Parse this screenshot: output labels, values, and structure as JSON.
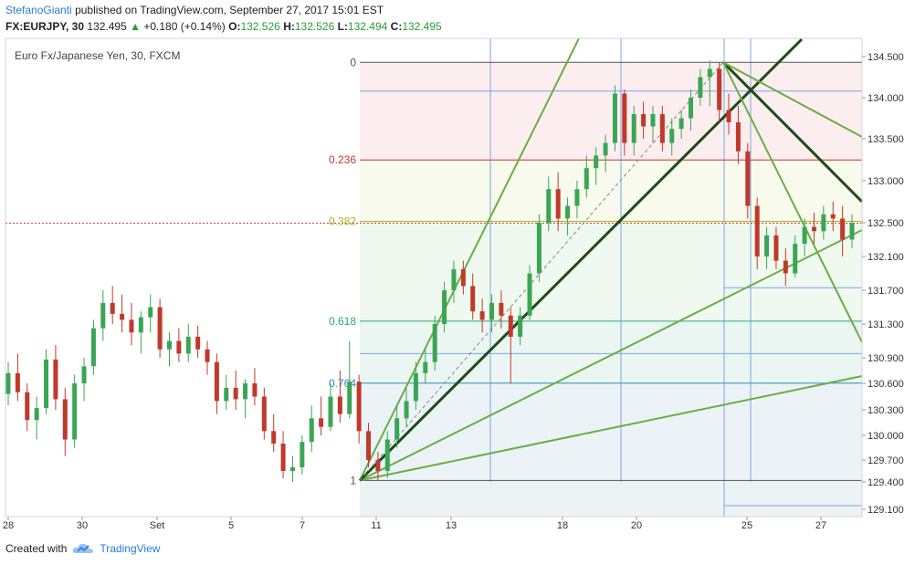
{
  "header": {
    "author": "StefanoGianti",
    "published_text": "published on TradingView.com, September 27, 2017 15:01 EST",
    "symbol": "FX:EURJPY, 30",
    "last": "132.495",
    "change": "+0.180 (+0.14%)",
    "o_label": "O:",
    "o_value": "132.526",
    "h_label": "H:",
    "h_value": "132.526",
    "l_label": "L:",
    "l_value": "132.494",
    "c_label": "C:",
    "c_value": "132.495"
  },
  "footer": {
    "created_with": "Created with",
    "brand": "TradingView"
  },
  "colors": {
    "up": "#3aa655",
    "down": "#c0392b",
    "fib_line": "#2b2b2b",
    "grid_blue": "#7aa6e8",
    "fan_light": "#6aad45",
    "fan_dark": "#1e4a18",
    "price_line": "#d43c3c"
  },
  "chart_data": {
    "type": "candlestick",
    "title": "Euro Fx/Japanese Yen, 30, FXCM",
    "x_tick_labels": [
      "28",
      "30",
      "Set",
      "5",
      "7",
      "11",
      "13",
      "18",
      "20",
      "25",
      "27"
    ],
    "y_ticks": [
      129.1,
      129.4,
      129.7,
      130.0,
      130.3,
      130.6,
      130.9,
      131.3,
      131.7,
      132.1,
      132.5,
      133.0,
      133.5,
      134.0,
      134.5
    ],
    "y_tick_labels": [
      "129.100",
      "129.400",
      "129.700",
      "130.000",
      "130.300",
      "130.600",
      "130.900",
      "131.300",
      "131.700",
      "132.100",
      "132.500",
      "133.000",
      "133.500",
      "134.000",
      "134.500"
    ],
    "current_price": 132.495,
    "fib_retracement": {
      "high": 134.43,
      "low": 129.42,
      "levels": [
        {
          "ratio": 0,
          "label": "0",
          "color": "#555555"
        },
        {
          "ratio": 0.236,
          "label": "0.236",
          "color": "#c0392b"
        },
        {
          "ratio": 0.382,
          "label": "0.382",
          "color": "#a8b820"
        },
        {
          "ratio": 0.618,
          "label": "0.618",
          "color": "#2aa87a"
        },
        {
          "ratio": 0.764,
          "label": "0.764",
          "color": "#2a8ac0"
        },
        {
          "ratio": 1,
          "label": "1",
          "color": "#555555"
        }
      ]
    },
    "horizontal_levels": [
      134.08,
      131.73,
      130.95,
      129.14
    ],
    "candles": [
      {
        "o": 130.48,
        "h": 130.85,
        "l": 130.35,
        "c": 130.72
      },
      {
        "o": 130.72,
        "h": 130.95,
        "l": 130.4,
        "c": 130.5
      },
      {
        "o": 130.5,
        "h": 130.6,
        "l": 130.05,
        "c": 130.18
      },
      {
        "o": 130.18,
        "h": 130.45,
        "l": 129.95,
        "c": 130.32
      },
      {
        "o": 130.32,
        "h": 131.0,
        "l": 130.25,
        "c": 130.88
      },
      {
        "o": 130.88,
        "h": 131.05,
        "l": 130.3,
        "c": 130.42
      },
      {
        "o": 130.42,
        "h": 130.55,
        "l": 129.75,
        "c": 129.95
      },
      {
        "o": 129.95,
        "h": 130.7,
        "l": 129.85,
        "c": 130.6
      },
      {
        "o": 130.6,
        "h": 130.9,
        "l": 130.4,
        "c": 130.8
      },
      {
        "o": 130.8,
        "h": 131.35,
        "l": 130.7,
        "c": 131.25
      },
      {
        "o": 131.25,
        "h": 131.7,
        "l": 131.1,
        "c": 131.55
      },
      {
        "o": 131.55,
        "h": 131.75,
        "l": 131.3,
        "c": 131.42
      },
      {
        "o": 131.42,
        "h": 131.65,
        "l": 131.2,
        "c": 131.35
      },
      {
        "o": 131.35,
        "h": 131.55,
        "l": 131.05,
        "c": 131.2
      },
      {
        "o": 131.2,
        "h": 131.45,
        "l": 130.95,
        "c": 131.38
      },
      {
        "o": 131.38,
        "h": 131.65,
        "l": 131.2,
        "c": 131.5
      },
      {
        "o": 131.5,
        "h": 131.6,
        "l": 130.9,
        "c": 131.0
      },
      {
        "o": 131.0,
        "h": 131.2,
        "l": 130.8,
        "c": 131.1
      },
      {
        "o": 131.1,
        "h": 131.25,
        "l": 130.85,
        "c": 130.95
      },
      {
        "o": 130.95,
        "h": 131.3,
        "l": 130.85,
        "c": 131.15
      },
      {
        "o": 131.15,
        "h": 131.28,
        "l": 130.9,
        "c": 131.0
      },
      {
        "o": 131.0,
        "h": 131.1,
        "l": 130.7,
        "c": 130.85
      },
      {
        "o": 130.85,
        "h": 130.95,
        "l": 130.25,
        "c": 130.4
      },
      {
        "o": 130.4,
        "h": 130.7,
        "l": 130.3,
        "c": 130.55
      },
      {
        "o": 130.55,
        "h": 130.75,
        "l": 130.3,
        "c": 130.42
      },
      {
        "o": 130.42,
        "h": 130.65,
        "l": 130.2,
        "c": 130.6
      },
      {
        "o": 130.6,
        "h": 130.78,
        "l": 130.35,
        "c": 130.45
      },
      {
        "o": 130.45,
        "h": 130.55,
        "l": 129.95,
        "c": 130.05
      },
      {
        "o": 130.05,
        "h": 130.25,
        "l": 129.8,
        "c": 129.9
      },
      {
        "o": 129.9,
        "h": 130.05,
        "l": 129.45,
        "c": 129.55
      },
      {
        "o": 129.55,
        "h": 129.75,
        "l": 129.4,
        "c": 129.6
      },
      {
        "o": 129.6,
        "h": 130.0,
        "l": 129.5,
        "c": 129.92
      },
      {
        "o": 129.92,
        "h": 130.35,
        "l": 129.8,
        "c": 130.2
      },
      {
        "o": 130.2,
        "h": 130.45,
        "l": 130.0,
        "c": 130.1
      },
      {
        "o": 130.1,
        "h": 130.6,
        "l": 130.05,
        "c": 130.45
      },
      {
        "o": 130.45,
        "h": 130.75,
        "l": 130.15,
        "c": 130.25
      },
      {
        "o": 130.25,
        "h": 131.1,
        "l": 130.2,
        "c": 130.62
      },
      {
        "o": 130.62,
        "h": 130.7,
        "l": 129.9,
        "c": 130.05
      },
      {
        "o": 130.05,
        "h": 130.15,
        "l": 129.6,
        "c": 129.7
      },
      {
        "o": 129.7,
        "h": 129.8,
        "l": 129.42,
        "c": 129.55
      },
      {
        "o": 129.55,
        "h": 130.05,
        "l": 129.45,
        "c": 129.95
      },
      {
        "o": 129.95,
        "h": 130.35,
        "l": 129.85,
        "c": 130.2
      },
      {
        "o": 130.2,
        "h": 130.55,
        "l": 130.1,
        "c": 130.4
      },
      {
        "o": 130.4,
        "h": 130.85,
        "l": 130.3,
        "c": 130.72
      },
      {
        "o": 130.72,
        "h": 131.0,
        "l": 130.6,
        "c": 130.85
      },
      {
        "o": 130.85,
        "h": 131.4,
        "l": 130.75,
        "c": 131.3
      },
      {
        "o": 131.3,
        "h": 131.8,
        "l": 131.2,
        "c": 131.7
      },
      {
        "o": 131.7,
        "h": 132.05,
        "l": 131.55,
        "c": 131.95
      },
      {
        "o": 131.95,
        "h": 132.05,
        "l": 131.65,
        "c": 131.75
      },
      {
        "o": 131.75,
        "h": 131.9,
        "l": 131.35,
        "c": 131.45
      },
      {
        "o": 131.45,
        "h": 131.6,
        "l": 131.2,
        "c": 131.35
      },
      {
        "o": 131.35,
        "h": 131.65,
        "l": 131.2,
        "c": 131.55
      },
      {
        "o": 131.55,
        "h": 131.7,
        "l": 131.25,
        "c": 131.4
      },
      {
        "o": 131.4,
        "h": 131.5,
        "l": 130.6,
        "c": 131.15
      },
      {
        "o": 131.15,
        "h": 131.5,
        "l": 131.05,
        "c": 131.4
      },
      {
        "o": 131.4,
        "h": 132.0,
        "l": 131.35,
        "c": 131.9
      },
      {
        "o": 131.9,
        "h": 132.6,
        "l": 131.8,
        "c": 132.5
      },
      {
        "o": 132.5,
        "h": 133.05,
        "l": 132.4,
        "c": 132.9
      },
      {
        "o": 132.9,
        "h": 133.1,
        "l": 132.4,
        "c": 132.55
      },
      {
        "o": 132.55,
        "h": 132.8,
        "l": 132.35,
        "c": 132.7
      },
      {
        "o": 132.7,
        "h": 133.0,
        "l": 132.55,
        "c": 132.9
      },
      {
        "o": 132.9,
        "h": 133.3,
        "l": 132.8,
        "c": 133.15
      },
      {
        "o": 133.15,
        "h": 133.4,
        "l": 132.95,
        "c": 133.3
      },
      {
        "o": 133.3,
        "h": 133.55,
        "l": 133.1,
        "c": 133.45
      },
      {
        "o": 133.45,
        "h": 134.15,
        "l": 133.35,
        "c": 134.05
      },
      {
        "o": 134.05,
        "h": 134.1,
        "l": 133.3,
        "c": 133.45
      },
      {
        "o": 133.45,
        "h": 133.9,
        "l": 133.3,
        "c": 133.8
      },
      {
        "o": 133.8,
        "h": 133.95,
        "l": 133.5,
        "c": 133.65
      },
      {
        "o": 133.65,
        "h": 133.9,
        "l": 133.45,
        "c": 133.8
      },
      {
        "o": 133.8,
        "h": 133.9,
        "l": 133.35,
        "c": 133.45
      },
      {
        "o": 133.45,
        "h": 133.75,
        "l": 133.3,
        "c": 133.62
      },
      {
        "o": 133.62,
        "h": 133.85,
        "l": 133.5,
        "c": 133.75
      },
      {
        "o": 133.75,
        "h": 134.1,
        "l": 133.6,
        "c": 134.0
      },
      {
        "o": 134.0,
        "h": 134.35,
        "l": 133.9,
        "c": 134.25
      },
      {
        "o": 134.25,
        "h": 134.45,
        "l": 133.9,
        "c": 134.35
      },
      {
        "o": 134.35,
        "h": 134.43,
        "l": 133.7,
        "c": 133.85
      },
      {
        "o": 133.85,
        "h": 134.05,
        "l": 133.55,
        "c": 133.7
      },
      {
        "o": 133.7,
        "h": 133.9,
        "l": 133.2,
        "c": 133.35
      },
      {
        "o": 133.35,
        "h": 133.45,
        "l": 132.55,
        "c": 132.7
      },
      {
        "o": 132.7,
        "h": 132.8,
        "l": 131.95,
        "c": 132.1
      },
      {
        "o": 132.1,
        "h": 132.45,
        "l": 131.95,
        "c": 132.35
      },
      {
        "o": 132.35,
        "h": 132.45,
        "l": 131.95,
        "c": 132.05
      },
      {
        "o": 132.05,
        "h": 132.2,
        "l": 131.75,
        "c": 131.9
      },
      {
        "o": 131.9,
        "h": 132.35,
        "l": 131.85,
        "c": 132.25
      },
      {
        "o": 132.25,
        "h": 132.55,
        "l": 132.1,
        "c": 132.45
      },
      {
        "o": 132.45,
        "h": 132.62,
        "l": 132.25,
        "c": 132.4
      },
      {
        "o": 132.4,
        "h": 132.7,
        "l": 132.3,
        "c": 132.6
      },
      {
        "o": 132.6,
        "h": 132.75,
        "l": 132.4,
        "c": 132.55
      },
      {
        "o": 132.55,
        "h": 132.7,
        "l": 132.1,
        "c": 132.3
      },
      {
        "o": 132.3,
        "h": 132.6,
        "l": 132.2,
        "c": 132.495
      }
    ]
  }
}
